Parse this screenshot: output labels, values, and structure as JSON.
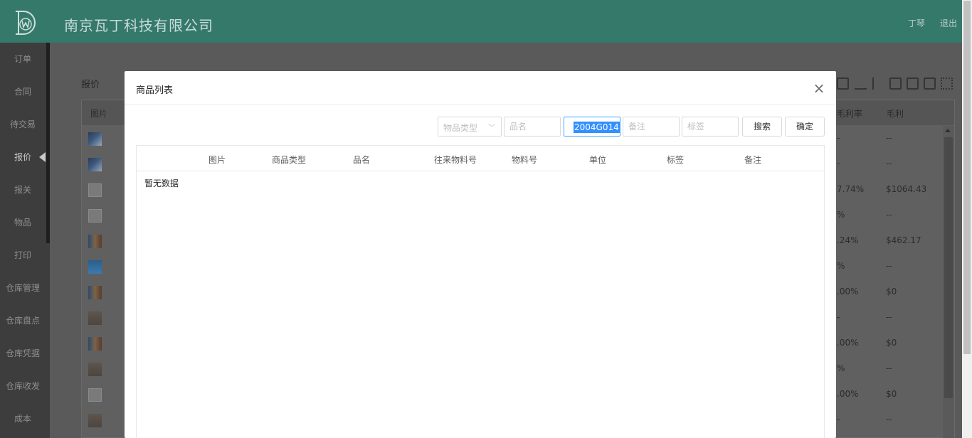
{
  "header": {
    "logo_icon": "dw-logo",
    "company": "南京瓦丁科技有限公司",
    "user": "丁琴",
    "logout": "退出",
    "color": "#35796b"
  },
  "sidebar": {
    "active": "报价",
    "items": [
      {
        "label": "订单"
      },
      {
        "label": "合同"
      },
      {
        "label": "待交易"
      },
      {
        "label": "报价"
      },
      {
        "label": "报关"
      },
      {
        "label": "物品"
      },
      {
        "label": "打印"
      },
      {
        "label": "仓库管理"
      },
      {
        "label": "仓库盘点"
      },
      {
        "label": "仓库凭据"
      },
      {
        "label": "仓库收发"
      },
      {
        "label": "成本"
      }
    ]
  },
  "background_page": {
    "title": "报价",
    "columns": {
      "image": "图片",
      "margin_rate": "毛利率",
      "margin": "毛利"
    },
    "toolbar_icons": [
      "cart-icon",
      "bar-chart-icon",
      "sort-icon",
      "exit-icon",
      "export-icon",
      "file-icon",
      "qrcode-icon"
    ],
    "rows": [
      {
        "thumb": "a",
        "rate": "-",
        "profit": "--"
      },
      {
        "thumb": "a",
        "rate": "-",
        "profit": "--"
      },
      {
        "thumb": "b",
        "rate": "7.74%",
        "profit": "$1064.43"
      },
      {
        "thumb": "b",
        "rate": "%",
        "profit": "--"
      },
      {
        "thumb": "c",
        "rate": ".24%",
        "profit": "$462.17"
      },
      {
        "thumb": "d",
        "rate": "%",
        "profit": "--"
      },
      {
        "thumb": "c",
        "rate": ".00%",
        "profit": "$0"
      },
      {
        "thumb": "e",
        "rate": "-",
        "profit": "--"
      },
      {
        "thumb": "c",
        "rate": ".00%",
        "profit": "$0"
      },
      {
        "thumb": "e",
        "rate": "%",
        "profit": "--"
      },
      {
        "thumb": "b",
        "rate": ".00%",
        "profit": "$0"
      },
      {
        "thumb": "e",
        "rate": "-",
        "profit": "--"
      }
    ]
  },
  "modal": {
    "title": "商品列表",
    "close_icon": "close-icon",
    "filters": {
      "type_placeholder": "物品类型",
      "name_placeholder": "品名",
      "material_no_value": "2004G014",
      "remark_placeholder": "备注",
      "tag_placeholder": "标签"
    },
    "buttons": {
      "search": "搜索",
      "confirm": "确定"
    },
    "columns": [
      "图片",
      "商品类型",
      "品名",
      "往来物料号",
      "物料号",
      "单位",
      "标签",
      "备注"
    ],
    "empty_text": "暂无数据"
  }
}
